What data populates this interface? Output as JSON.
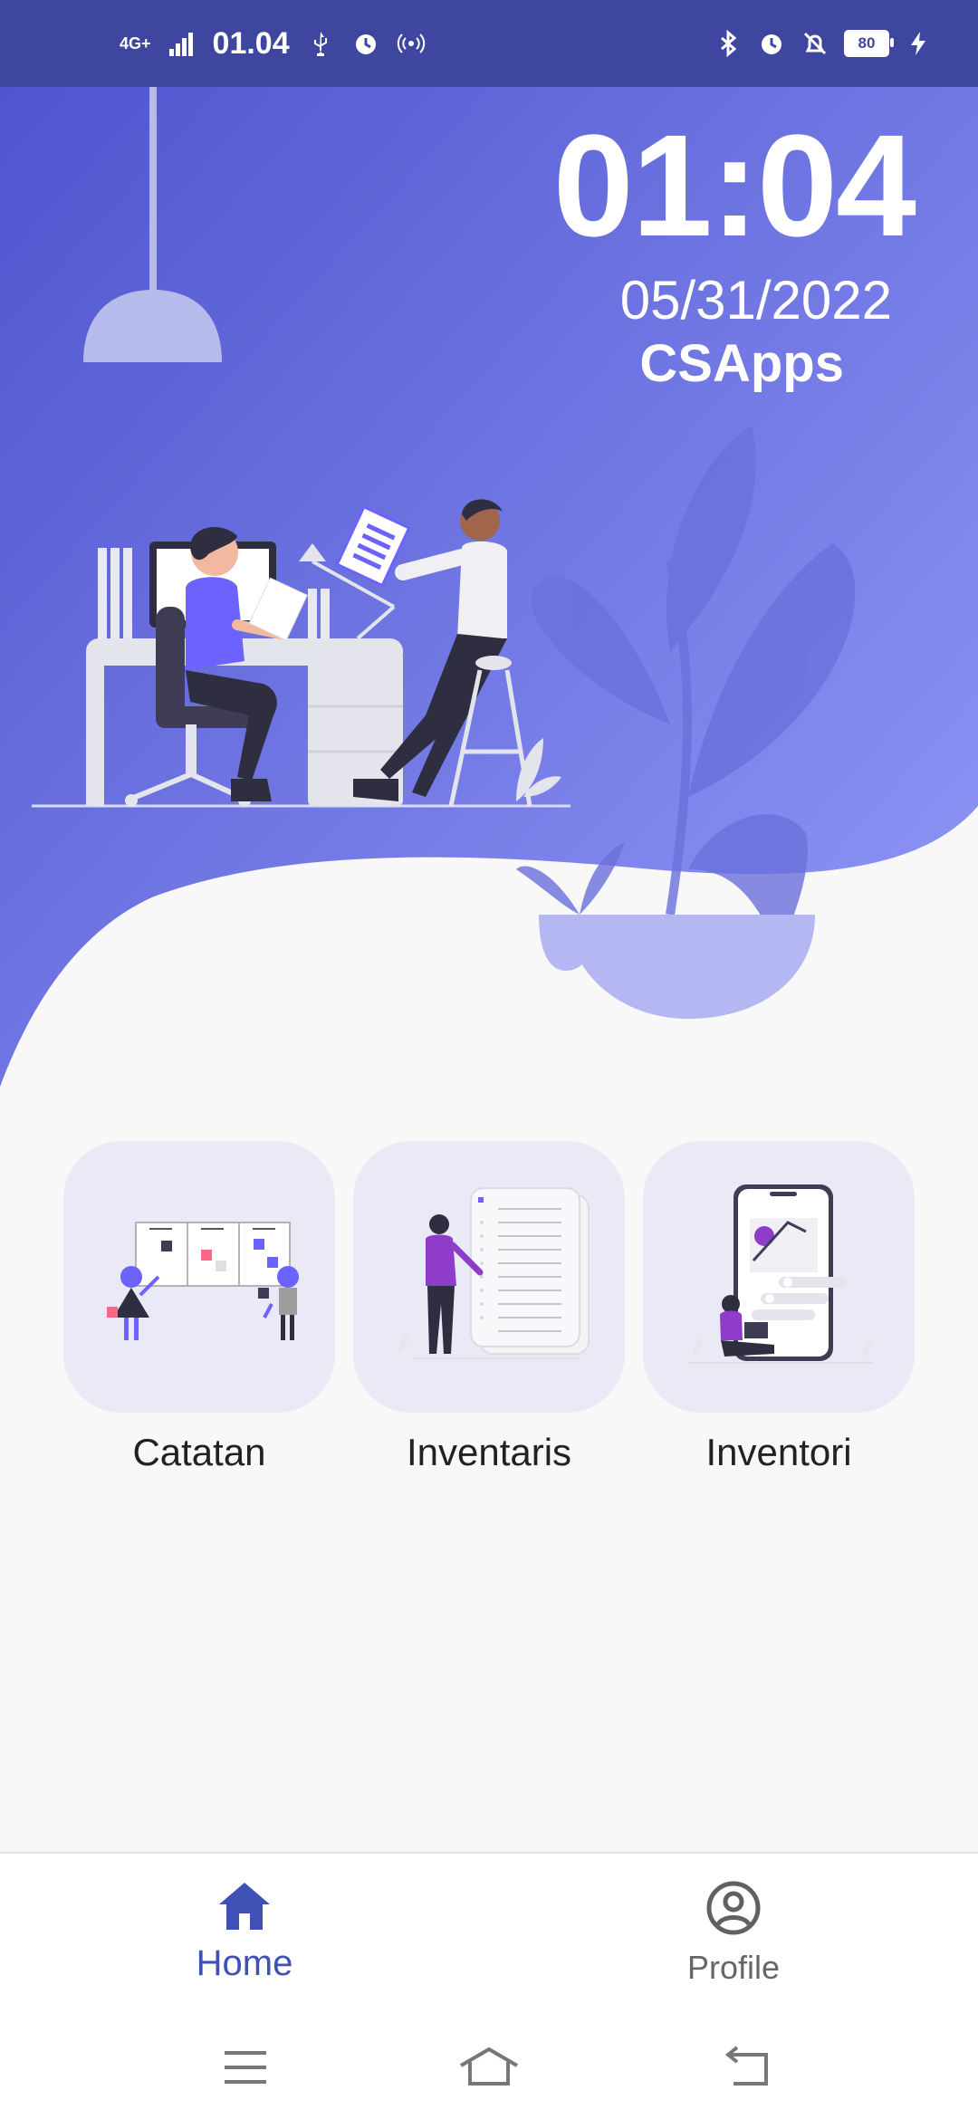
{
  "status_bar": {
    "network": "4G+",
    "time": "01.04",
    "battery": "80"
  },
  "clock": {
    "time": "01:04",
    "date": "05/31/2022",
    "app_name": "CSApps"
  },
  "menu": [
    {
      "label": "Catatan",
      "icon": "kanban-board-illustration"
    },
    {
      "label": "Inventaris",
      "icon": "document-list-illustration"
    },
    {
      "label": "Inventori",
      "icon": "mobile-app-illustration"
    }
  ],
  "bottom_nav": {
    "items": [
      {
        "label": "Home",
        "icon": "home-icon",
        "active": true
      },
      {
        "label": "Profile",
        "icon": "profile-icon",
        "active": false
      }
    ]
  },
  "colors": {
    "primary": "#3f51b5",
    "hero_top": "#4e55cf",
    "hero_bottom": "#8d94f7",
    "status_bar": "#3f46a0",
    "tile": "#e9eaf6",
    "accent_purple": "#6c63ff"
  }
}
